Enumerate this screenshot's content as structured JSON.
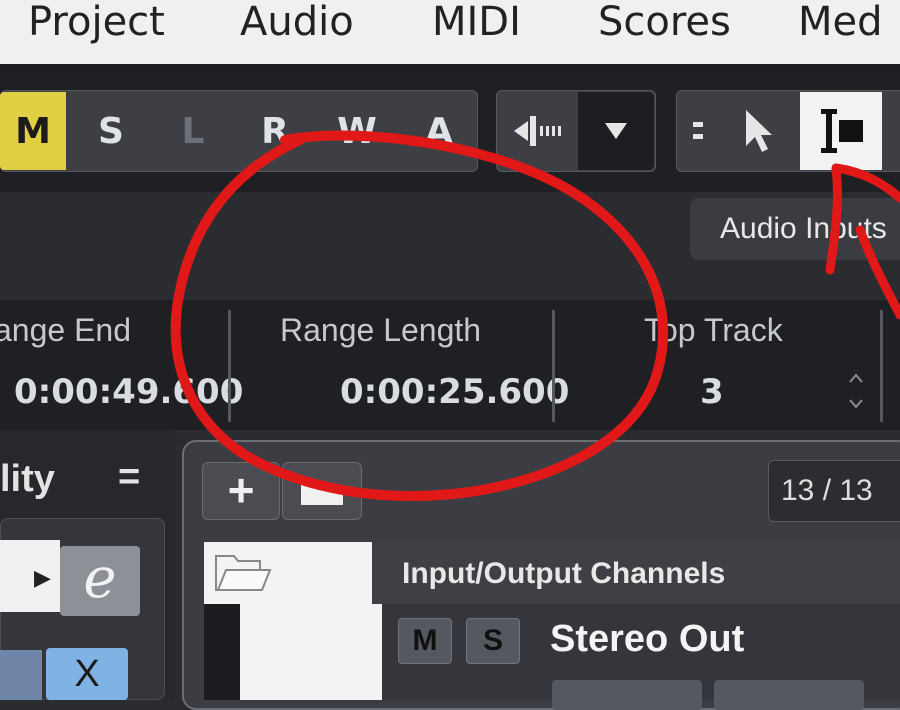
{
  "menu": {
    "items": [
      "Project",
      "Audio",
      "MIDI",
      "Scores",
      "Med"
    ]
  },
  "toolbar": {
    "state_buttons": [
      "M",
      "S",
      "L",
      "R",
      "W",
      "A"
    ],
    "tooltip": "Audio Inputs"
  },
  "info_line": {
    "fields": [
      {
        "label": "ange End",
        "value": "0:00:49.600"
      },
      {
        "label": "Range Length",
        "value": "0:00:25.600"
      },
      {
        "label": "Top Track",
        "value": "3"
      }
    ]
  },
  "inspector": {
    "title": "lity",
    "menu_glyph": "=",
    "e_glyph": "e",
    "x_glyph": "X"
  },
  "panel": {
    "add_label": "+",
    "counter": "13 / 13",
    "folder_title": "Input/Output Channels",
    "mute_label": "M",
    "solo_label": "S",
    "channel_name": "Stereo Out"
  },
  "colors": {
    "mute_active": "#e2d044",
    "annotation": "#e01818",
    "tool_active": "#f2f2f2"
  }
}
